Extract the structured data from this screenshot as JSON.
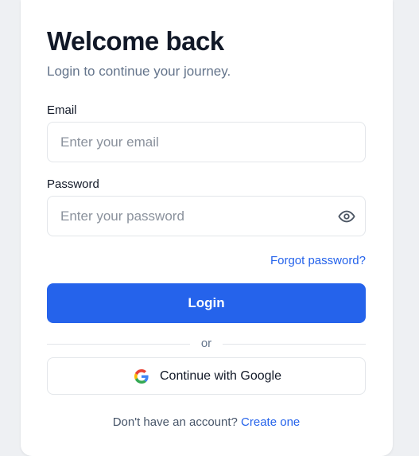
{
  "header": {
    "title": "Welcome back",
    "subtitle": "Login to continue your journey."
  },
  "form": {
    "email": {
      "label": "Email",
      "placeholder": "Enter your email",
      "value": ""
    },
    "password": {
      "label": "Password",
      "placeholder": "Enter your password",
      "value": "",
      "toggle_icon": "eye-icon"
    },
    "forgot_link": "Forgot password?",
    "login_label": "Login"
  },
  "divider": {
    "text": "or"
  },
  "google": {
    "label": "Continue with Google",
    "icon": "google-icon"
  },
  "signup": {
    "prompt": "Don't have an account?",
    "link": "Create one"
  },
  "colors": {
    "primary": "#2563eb",
    "heading": "#111827",
    "muted": "#64748b",
    "border": "#e3e6ea",
    "background": "#eef0f3",
    "card": "#ffffff"
  }
}
